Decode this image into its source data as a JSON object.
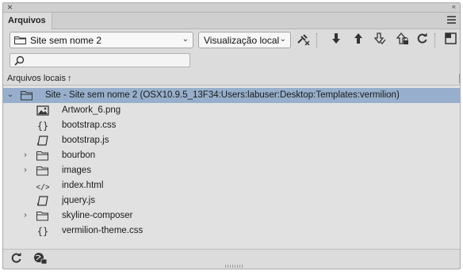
{
  "panel": {
    "tab_label": "Arquivos"
  },
  "toolbar": {
    "site_select": "Site sem nome 2",
    "view_select": "Visualização local",
    "buttons": [
      "disconnect-icon",
      "get-icon",
      "put-icon",
      "check-in-icon",
      "check-out-icon",
      "refresh-icon",
      "expand-icon"
    ]
  },
  "search": {
    "placeholder": ""
  },
  "header": {
    "label": "Arquivos locais",
    "sort_arrow": "↑"
  },
  "tree": {
    "root": {
      "label": "Site - Site sem nome 2 (OSX10.9.5_13F34:Users:labuser:Desktop:Templates:vermilion)",
      "expanded": true
    },
    "items": [
      {
        "name": "Artwork_6.png",
        "icon": "image-icon",
        "folder": false
      },
      {
        "name": "bootstrap.css",
        "icon": "css-icon",
        "folder": false
      },
      {
        "name": "bootstrap.js",
        "icon": "script-icon",
        "folder": false
      },
      {
        "name": "bourbon",
        "icon": "folder-icon",
        "folder": true
      },
      {
        "name": "images",
        "icon": "folder-icon",
        "folder": true
      },
      {
        "name": "index.html",
        "icon": "html-icon",
        "folder": false
      },
      {
        "name": "jquery.js",
        "icon": "script-icon",
        "folder": false
      },
      {
        "name": "skyline-composer",
        "icon": "folder-icon",
        "folder": true
      },
      {
        "name": "vermilion-theme.css",
        "icon": "css-icon",
        "folder": false
      }
    ]
  },
  "footer": {
    "buttons": [
      "refresh-icon",
      "site-settings-icon"
    ]
  },
  "colors": {
    "selection": "#97afcc",
    "panel": "#dcdcdc",
    "tree_bg": "#e1e1e1"
  }
}
